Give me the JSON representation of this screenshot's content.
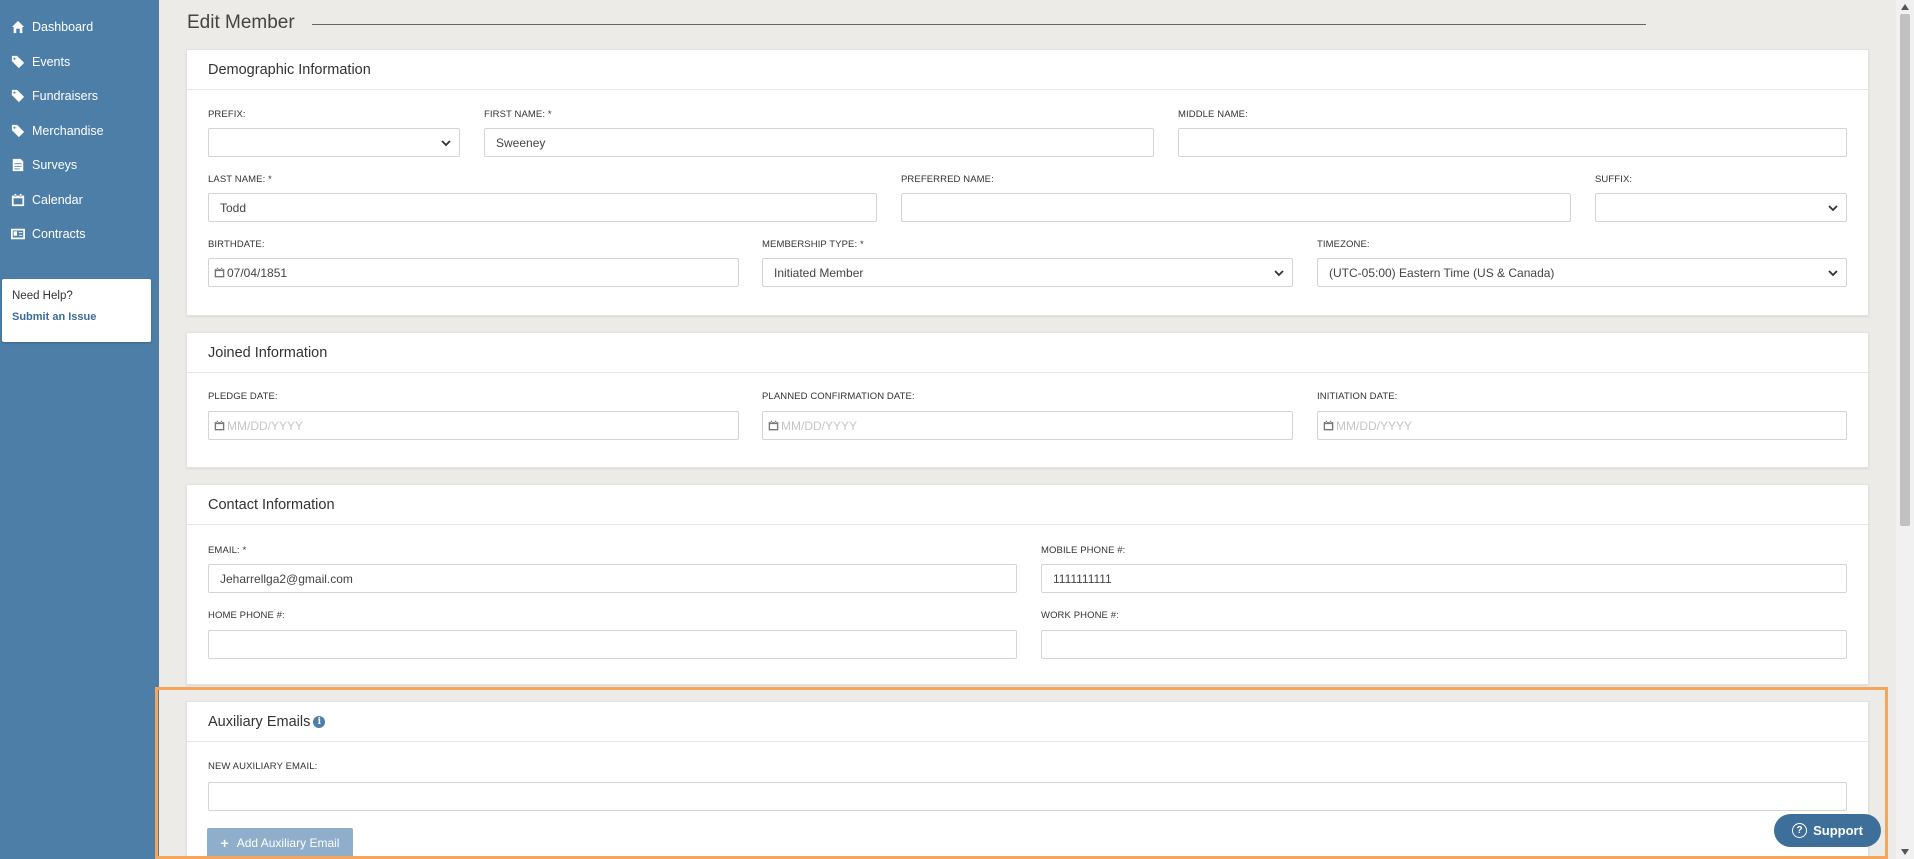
{
  "sidebar": {
    "items": [
      {
        "label": "Dashboard",
        "icon": "home-icon"
      },
      {
        "label": "Events",
        "icon": "tag-icon"
      },
      {
        "label": "Fundraisers",
        "icon": "tag-icon"
      },
      {
        "label": "Merchandise",
        "icon": "tag-icon"
      },
      {
        "label": "Surveys",
        "icon": "document-icon"
      },
      {
        "label": "Calendar",
        "icon": "calendar-icon"
      },
      {
        "label": "Contracts",
        "icon": "id-card-icon"
      }
    ],
    "help": {
      "title": "Need Help?",
      "link": "Submit an Issue"
    }
  },
  "page": {
    "title": "Edit Member"
  },
  "demographic": {
    "heading": "Demographic Information",
    "prefix_label": "PREFIX:",
    "prefix_value": "",
    "first_name_label": "FIRST NAME: *",
    "first_name_value": "Sweeney",
    "middle_name_label": "MIDDLE NAME:",
    "middle_name_value": "",
    "last_name_label": "LAST NAME: *",
    "last_name_value": "Todd",
    "preferred_name_label": "PREFERRED NAME:",
    "preferred_name_value": "",
    "suffix_label": "SUFFIX:",
    "suffix_value": "",
    "birthdate_label": "BIRTHDATE:",
    "birthdate_value": "07/04/1851",
    "membership_label": "MEMBERSHIP TYPE: *",
    "membership_value": "Initiated Member",
    "timezone_label": "TIMEZONE:",
    "timezone_value": "(UTC-05:00) Eastern Time (US & Canada)"
  },
  "joined": {
    "heading": "Joined Information",
    "pledge_label": "PLEDGE DATE:",
    "planned_label": "PLANNED CONFIRMATION DATE:",
    "initiation_label": "INITIATION DATE:",
    "date_placeholder": "MM/DD/YYYY"
  },
  "contact": {
    "heading": "Contact Information",
    "email_label": "EMAIL: *",
    "email_value": "Jeharrellga2@gmail.com",
    "mobile_label": "MOBILE PHONE #:",
    "mobile_value": "1111111111",
    "home_label": "HOME PHONE #:",
    "home_value": "",
    "work_label": "WORK PHONE #:",
    "work_value": ""
  },
  "auxiliary": {
    "heading": "Auxiliary Emails",
    "new_label": "NEW AUXILIARY EMAIL:",
    "new_value": "",
    "add_button": "Add Auxiliary Email"
  },
  "support": {
    "label": "Support"
  },
  "colors": {
    "sidebar": "#4c7ea8",
    "highlight": "#f5a65b",
    "support": "#3e6f9a",
    "add_button": "#8eaecb"
  }
}
